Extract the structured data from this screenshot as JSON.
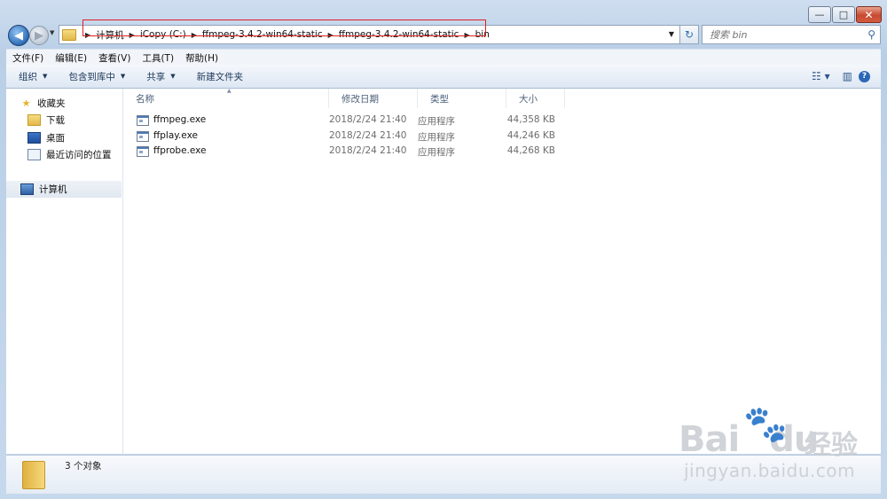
{
  "window": {
    "minimize_glyph": "—",
    "maximize_glyph": "□",
    "close_glyph": "✕"
  },
  "nav": {
    "back_glyph": "◀",
    "forward_glyph": "▶",
    "breadcrumbs": [
      "计算机",
      "iCopy (C:)",
      "ffmpeg-3.4.2-win64-static",
      "ffmpeg-3.4.2-win64-static",
      "bin"
    ],
    "search_placeholder": "搜索 bin"
  },
  "menubar": [
    "文件(F)",
    "编辑(E)",
    "查看(V)",
    "工具(T)",
    "帮助(H)"
  ],
  "toolbar": {
    "organize": "组织",
    "include_in_library": "包含到库中",
    "share": "共享",
    "new_folder": "新建文件夹"
  },
  "sidebar": {
    "favorites": "收藏夹",
    "downloads": "下载",
    "desktop": "桌面",
    "recent": "最近访问的位置",
    "computer": "计算机"
  },
  "columns": {
    "name": "名称",
    "date": "修改日期",
    "type": "类型",
    "size": "大小"
  },
  "files": [
    {
      "name": "ffmpeg.exe",
      "date": "2018/2/24 21:40",
      "type": "应用程序",
      "size": "44,358 KB"
    },
    {
      "name": "ffplay.exe",
      "date": "2018/2/24 21:40",
      "type": "应用程序",
      "size": "44,246 KB"
    },
    {
      "name": "ffprobe.exe",
      "date": "2018/2/24 21:40",
      "type": "应用程序",
      "size": "44,268 KB"
    }
  ],
  "status": "3 个对象",
  "watermark": {
    "brand": "Bai",
    "brand2": "du",
    "jingyan": "经验",
    "url": "jingyan.baidu.com"
  },
  "colors": {
    "highlight_box": "#e02020",
    "accent": "#2c66b7"
  }
}
